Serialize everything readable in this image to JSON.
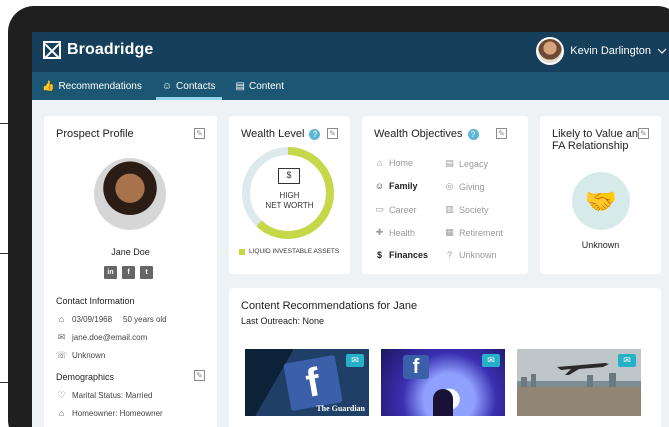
{
  "header": {
    "brand": "Broadridge",
    "user_name": "Kevin Darlington",
    "user_menu_icon": "chevron-down-icon"
  },
  "nav": {
    "tabs": [
      {
        "label": "Recommendations",
        "icon": "thumbs-up-icon"
      },
      {
        "label": "Contacts",
        "icon": "person-icon",
        "active": true
      },
      {
        "label": "Content",
        "icon": "document-icon"
      }
    ]
  },
  "prospect": {
    "title": "Prospect Profile",
    "name": "Jane Doe",
    "social": [
      "in",
      "f",
      "t"
    ],
    "contact_heading": "Contact Information",
    "dob": "03/09/1968",
    "age": "50 years old",
    "email": "jane.doe@email.com",
    "phone": "Unknown",
    "demographics_heading": "Demographics",
    "marital": "Marital Status: Married",
    "homeowner": "Homeowner: Homeowner"
  },
  "wealth": {
    "title": "Wealth Level",
    "help": "?",
    "level_line1": "HIGH",
    "level_line2": "NET WORTH",
    "legend": "LIQUID INVESTABLE ASSETS",
    "ring_fill_fraction": 0.62,
    "colors": {
      "fill": "#c6d84a",
      "track": "#dde9ec"
    }
  },
  "objectives": {
    "title": "Wealth Objectives",
    "help": "?",
    "left": [
      {
        "label": "Home",
        "icon": "home-icon",
        "selected": false
      },
      {
        "label": "Family",
        "icon": "family-icon",
        "selected": true
      },
      {
        "label": "Career",
        "icon": "briefcase-icon",
        "selected": false
      },
      {
        "label": "Health",
        "icon": "medical-icon",
        "selected": false
      },
      {
        "label": "Finances",
        "icon": "money-bag-icon",
        "selected": true
      }
    ],
    "right": [
      {
        "label": "Legacy",
        "icon": "certificate-icon",
        "selected": false
      },
      {
        "label": "Giving",
        "icon": "giving-icon",
        "selected": false
      },
      {
        "label": "Society",
        "icon": "institution-icon",
        "selected": false
      },
      {
        "label": "Retirement",
        "icon": "retirement-icon",
        "selected": false
      },
      {
        "label": "Unknown",
        "icon": "question-icon",
        "selected": false
      }
    ]
  },
  "likely": {
    "title_line1": "Likely to Value an",
    "title_line2": "FA Relationship",
    "value": "Unknown"
  },
  "content": {
    "title": "Content Recommendations for Jane",
    "last_outreach": "Last Outreach: None",
    "thumbs": [
      {
        "caption": "The Guardian",
        "icon": "mail-icon"
      },
      {
        "caption": "",
        "icon": "mail-icon"
      },
      {
        "caption": "",
        "icon": "mail-icon"
      }
    ]
  }
}
